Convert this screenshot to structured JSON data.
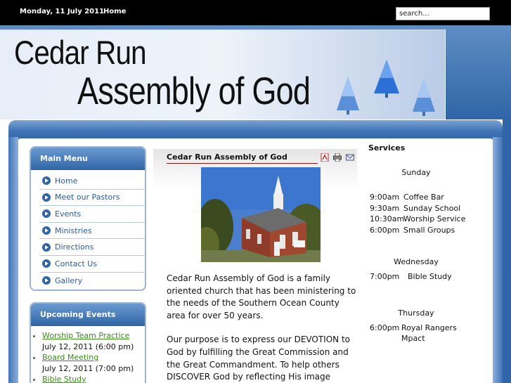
{
  "topbar": {
    "date": "Monday, 11 July 2011",
    "home_link": "Home",
    "search_placeholder": "search..."
  },
  "header": {
    "title_line1": "Cedar Run",
    "title_line2": "Assembly of God"
  },
  "main_menu": {
    "title": "Main Menu",
    "items": [
      "Home",
      "Meet our Pastors",
      "Events",
      "Ministries",
      "Directions",
      "Contact Us",
      "Gallery"
    ]
  },
  "upcoming_events": {
    "title": "Upcoming Events",
    "items": [
      {
        "title": "Worship Team Practice",
        "date": "July 12, 2011 (6:00 pm)"
      },
      {
        "title": "Board Meeting",
        "date": "July 12, 2011 (7:00 pm)"
      },
      {
        "title": "Bible Study",
        "date": ""
      }
    ]
  },
  "article": {
    "title": "Cedar Run Assembly of God",
    "icons": [
      "pdf-icon",
      "print-icon",
      "email-icon"
    ],
    "paragraphs": [
      "Cedar Run Assembly of God is a family oriented church that has been ministering to the needs of the Southern Ocean County area for over 50 years.",
      "Our purpose is to express our DEVOTION to God by fulfilling the Great Commission and the Great Commandment. To help others DISCOVER God by reflecting His image"
    ]
  },
  "services": {
    "title": "Services",
    "days": [
      {
        "day": "Sunday",
        "entries": [
          {
            "time": "9:00am",
            "event": "Coffee Bar"
          },
          {
            "time": "9:30am",
            "event": "Sunday School"
          },
          {
            "time": "10:30am",
            "event": "Worship Service"
          },
          {
            "time": "6:00pm",
            "event": "Small Groups"
          }
        ]
      },
      {
        "day": "Wednesday",
        "entries": [
          {
            "time": "7:00pm",
            "event": "Bible Study"
          }
        ]
      },
      {
        "day": "Thursday",
        "entries": [
          {
            "time": "6:00pm",
            "event": "Royal Rangers"
          },
          {
            "time": "",
            "event": "Mpact"
          }
        ]
      }
    ]
  },
  "colors": {
    "header_blue": "#2f65a6",
    "link_blue": "#2a5a9a",
    "event_green": "#3a8a1a"
  }
}
